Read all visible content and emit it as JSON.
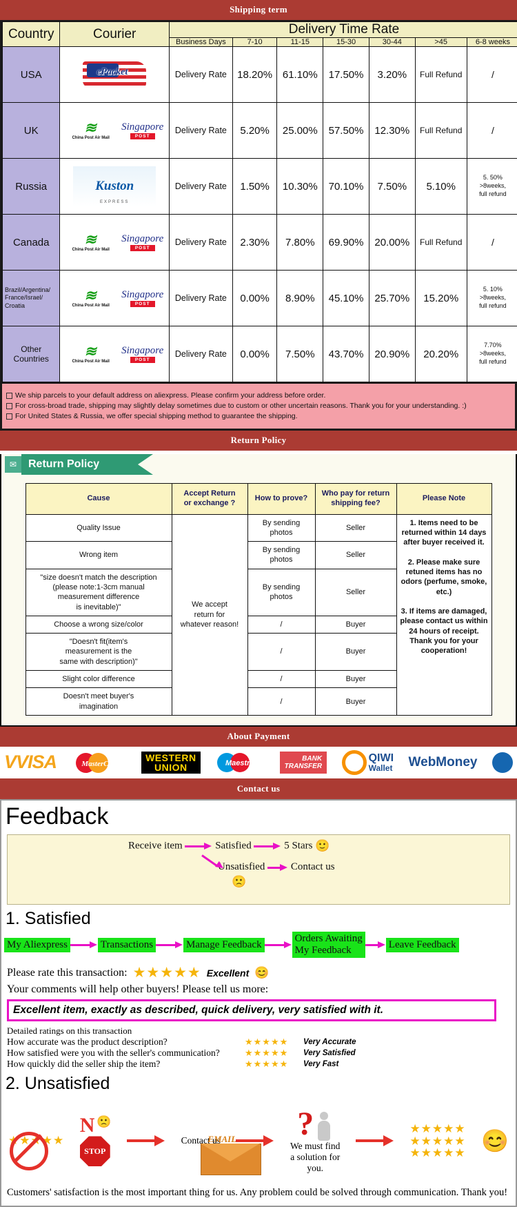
{
  "banners": {
    "shipping": "Shipping term",
    "return": "Return Policy",
    "payment": "About Payment",
    "contact": "Contact us"
  },
  "shipping": {
    "headers": {
      "country": "Country",
      "courier": "Courier",
      "delivery_time_rate": "Delivery Time Rate",
      "business_days": "Business Days",
      "d1": "7-10",
      "d2": "11-15",
      "d3": "15-30",
      "d4": "30-44",
      "d5": ">45",
      "d6": "6-8 weeks"
    },
    "rows": [
      {
        "country": "USA",
        "couriers": [
          "epacket"
        ],
        "label": "Delivery Rate",
        "v1": "18.20%",
        "v2": "61.10%",
        "v3": "17.50%",
        "v4": "3.20%",
        "v5": "Full Refund",
        "v6": "/"
      },
      {
        "country": "UK",
        "couriers": [
          "china-post-air-mail",
          "singapore-post"
        ],
        "label": "Delivery Rate",
        "v1": "5.20%",
        "v2": "25.00%",
        "v3": "57.50%",
        "v4": "12.30%",
        "v5": "Full Refund",
        "v6": "/"
      },
      {
        "country": "Russia",
        "couriers": [
          "kuston-express"
        ],
        "label": "Delivery Rate",
        "v1": "1.50%",
        "v2": "10.30%",
        "v3": "70.10%",
        "v4": "7.50%",
        "v5": "5.10%",
        "v6": "5. 50%\n>8weeks,\nfull refund"
      },
      {
        "country": "Canada",
        "couriers": [
          "china-post-air-mail",
          "singapore-post"
        ],
        "label": "Delivery Rate",
        "v1": "2.30%",
        "v2": "7.80%",
        "v3": "69.90%",
        "v4": "20.00%",
        "v5": "Full Refund",
        "v6": "/"
      },
      {
        "country": "Brazil/Argentina/\nFrance/Israel/\nCroatia",
        "couriers": [
          "china-post-air-mail",
          "singapore-post"
        ],
        "label": "Delivery Rate",
        "v1": "0.00%",
        "v2": "8.90%",
        "v3": "45.10%",
        "v4": "25.70%",
        "v5": "15.20%",
        "v6": "5. 10%\n>8weeks,\nfull refund"
      },
      {
        "country": "Other Countries",
        "couriers": [
          "china-post-air-mail",
          "singapore-post"
        ],
        "label": "Delivery Rate",
        "v1": "0.00%",
        "v2": "7.50%",
        "v3": "43.70%",
        "v4": "20.90%",
        "v5": "20.20%",
        "v6": "7.70%\n>8weeks,\nfull refund"
      }
    ],
    "notes": [
      "We ship parcels to your default address on aliexpress. Please confirm your address before order.",
      "For cross-broad trade, shipping may slightly delay sometimes due to custom or other uncertain reasons. Thank you for your understanding. :)",
      "For United States & Russia, we offer special shipping method to guarantee the shipping."
    ],
    "courier_names": {
      "epacket": "ePacket",
      "china_post": "China Post Air Mail",
      "singapore_post": "Singapore",
      "singapore_post_sub": "POST",
      "kuston": "Kuston",
      "kuston_sub": "EXPRESS"
    }
  },
  "return_policy": {
    "tag_label": "Return Policy",
    "headers": [
      "Cause",
      "Accept Return\nor exchange ?",
      "How to prove?",
      "Who pay for return\nshipping fee?",
      "Please Note"
    ],
    "accept_cell": "We accept\nreturn for\nwhatever reason!",
    "note_cell": "1. Items need to be returned within 14 days after buyer received it.\n\n2. Please make sure retuned items has no odors (perfume, smoke, etc.)\n\n3. If items are damaged, please contact us within 24 hours of receipt.\nThank you for your cooperation!",
    "rows": [
      {
        "cause": "Quality Issue",
        "prove": "By sending\nphotos",
        "pay": "Seller"
      },
      {
        "cause": "Wrong item",
        "prove": "By sending\nphotos",
        "pay": "Seller"
      },
      {
        "cause": "\"size doesn't match the description\n(please note:1-3cm manual\nmeasurement difference\nis inevitable)\"",
        "prove": "By sending\nphotos",
        "pay": "Seller"
      },
      {
        "cause": "Choose a wrong size/color",
        "prove": "/",
        "pay": "Buyer"
      },
      {
        "cause": "\"Doesn't fit(item's\nmeasurement is the\nsame with description)\"",
        "prove": "/",
        "pay": "Buyer"
      },
      {
        "cause": "Slight color difference",
        "prove": "/",
        "pay": "Buyer"
      },
      {
        "cause": "Doesn't meet buyer's\nimagination",
        "prove": "/",
        "pay": "Buyer"
      }
    ]
  },
  "payment": {
    "methods": [
      {
        "name": "visa",
        "label": "VISA"
      },
      {
        "name": "mastercard",
        "label": "MasterCard"
      },
      {
        "name": "western-union",
        "label_1": "WESTERN",
        "label_2": "UNION"
      },
      {
        "name": "maestro",
        "label": "Maestro"
      },
      {
        "name": "bank-transfer",
        "label_1": "BANK",
        "label_2": "TRANSFER"
      },
      {
        "name": "qiwi-wallet",
        "label_1": "QIWI",
        "label_2": "Wallet"
      },
      {
        "name": "webmoney",
        "label": "WebMoney"
      }
    ]
  },
  "feedback": {
    "title": "Feedback",
    "flow": {
      "receive": "Receive item",
      "satisfied": "Satisfied",
      "five_stars": "5 Stars",
      "unsatisfied": "Unsatisfied",
      "contact": "Contact us",
      "happy_emoji": "🙂",
      "sad_emoji": "🙁"
    },
    "satisfied": {
      "heading": "1. Satisfied",
      "steps": [
        "My Aliexpress",
        "Transactions",
        "Manage Feedback",
        "Orders Awaiting\nMy Feedback",
        "Leave Feedback"
      ],
      "rate_label": "Please rate this transaction:",
      "stars": "★★★★★",
      "rating_word": "Excellent",
      "smiley": "😊",
      "comment_prompt": "Your comments will help other buyers! Please tell us more:",
      "comment_text": "Excellent item, exactly as described, quick delivery, very satisfied with it.",
      "detail_head": "Detailed ratings on this transaction",
      "details": [
        {
          "q": "How accurate was the product description?",
          "stars": "★★★★★",
          "v": "Very Accurate"
        },
        {
          "q": "How satisfied were you with the seller's communication?",
          "stars": "★★★★★",
          "v": "Very Satisfied"
        },
        {
          "q": "How quickly did the seller ship the item?",
          "stars": "★★★★★",
          "v": "Very Fast"
        }
      ]
    },
    "unsatisfied": {
      "heading": "2. Unsatisfied",
      "no_label": "N",
      "stop_label": "STOP",
      "email_label": "EMAIL",
      "contact_caption": "Contact us",
      "solution_caption": "We must find\na solution for\nyou.",
      "final_stars": "★★★★★",
      "sad_emoji": "🙁",
      "happy_emoji": "😊",
      "closing": "Customers' satisfaction is the most important thing for us. Any problem could be solved through communication. Thank you!"
    }
  },
  "colors": {
    "banner_red": "#ab3b33",
    "table_yellow": "#f1eec2",
    "country_purple": "#b8b1dd",
    "note_pink": "#f4a0a8",
    "chip_green": "#19e319",
    "arrow_magenta": "#e910c6",
    "star_gold": "#f5b40a"
  }
}
